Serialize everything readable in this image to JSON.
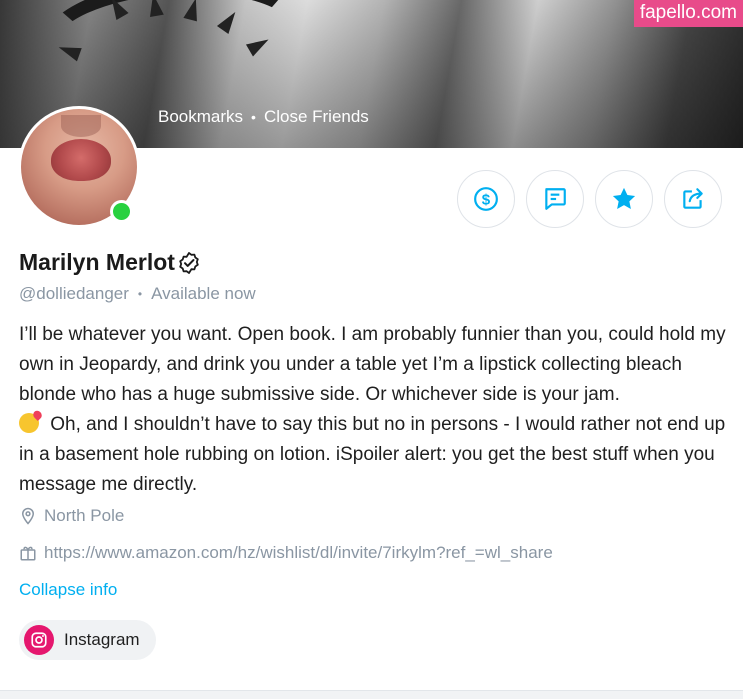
{
  "watermark": "fapello.com",
  "cover": {
    "links": [
      "Bookmarks",
      "Close Friends"
    ]
  },
  "profile": {
    "name": "Marilyn Merlot",
    "verified": true,
    "online": true,
    "handle": "@dolliedanger",
    "status": "Available now",
    "bio_part1": "I’ll be whatever you want. Open book. I am probably funnier than you, could hold my own in Jeopardy, and drink you under a table yet I’m a lipstick collecting bleach blonde who has a huge submissive side. Or whichever side is your jam.",
    "bio_part2": " Oh, and I shouldn’t have to say this but no in persons - I would rather not end up in a basement hole rubbing on lotion. iSpoiler alert: you get the best stuff when you message me directly.",
    "location": "North Pole",
    "wishlist_url": "https://www.amazon.com/hz/wishlist/dl/invite/7irkylm?ref_=wl_share",
    "collapse_label": "Collapse info"
  },
  "actions": [
    {
      "name": "tip-button",
      "icon": "dollar-icon"
    },
    {
      "name": "message-button",
      "icon": "message-icon"
    },
    {
      "name": "favorite-button",
      "icon": "star-icon"
    },
    {
      "name": "share-button",
      "icon": "share-icon"
    }
  ],
  "social": {
    "instagram_label": "Instagram"
  },
  "colors": {
    "accent": "#00aff0",
    "online": "#28d13f",
    "instagram": "#e5176e",
    "watermark": "#e84b8a"
  }
}
